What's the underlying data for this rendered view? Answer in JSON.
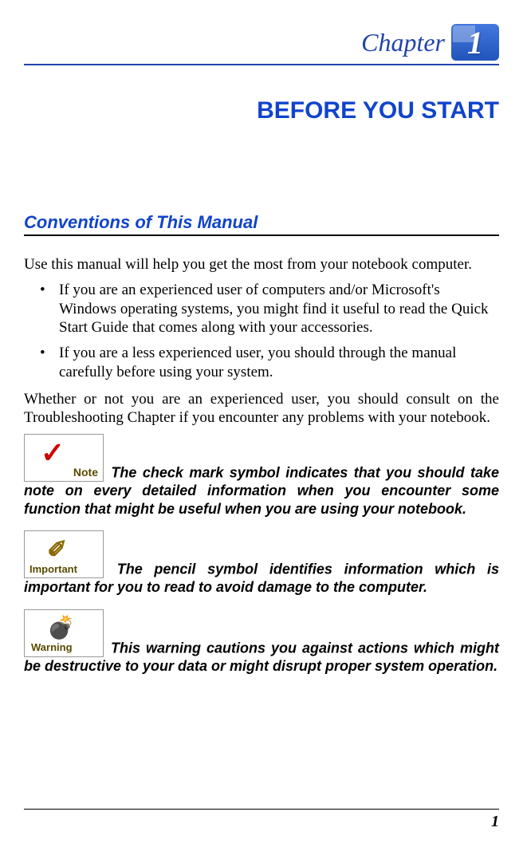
{
  "chapter": {
    "label": "Chapter",
    "number": "1"
  },
  "title": "BEFORE YOU START",
  "section_heading": "Conventions of This Manual",
  "intro": "Use this manual will help you get the most from your notebook computer.",
  "bullets": [
    "If you are an experienced user of computers and/or Microsoft's Windows operating systems, you might find it useful to read the Quick Start Guide that comes along with your accessories.",
    "If you are a less experienced user, you should through the manual carefully before using your system."
  ],
  "para2": "Whether or not you are an experienced user, you should consult on the Troubleshooting Chapter if you encounter any problems with your notebook.",
  "callouts": {
    "note": " The check mark symbol indicates that you should take note on every detailed information when you encounter some function that might be useful when you are using your notebook.",
    "important": " The pencil symbol identifies information which is important for you to read to avoid damage to the computer.",
    "warning": " This warning cautions you against actions which might be destructive to your data or might disrupt proper system operation."
  },
  "page_number": "1"
}
